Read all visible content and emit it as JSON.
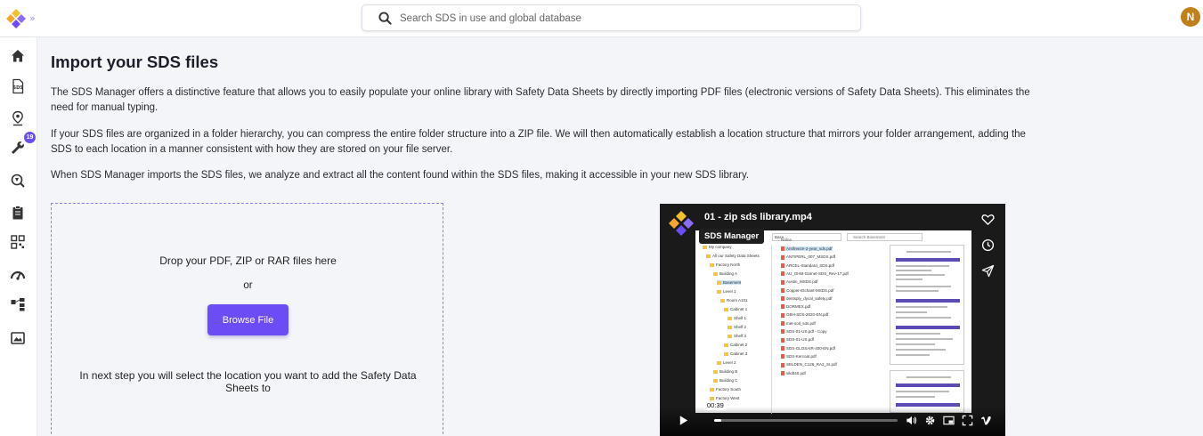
{
  "header": {
    "search_placeholder": "Search SDS in use and global database",
    "avatar_initial": "N"
  },
  "sidebar": {
    "items": [
      {
        "icon": "home-icon"
      },
      {
        "icon": "sds-document-icon",
        "label": "SDS"
      },
      {
        "icon": "location-pin-icon"
      },
      {
        "icon": "wrench-icon",
        "badge": "19"
      },
      {
        "icon": "search-chemical-icon"
      },
      {
        "icon": "clipboard-icon"
      },
      {
        "icon": "qr-code-icon"
      },
      {
        "icon": "risk-gauge-icon"
      },
      {
        "icon": "hierarchy-icon"
      },
      {
        "icon": "image-report-icon"
      }
    ]
  },
  "main": {
    "title": "Import your SDS files",
    "paragraphs": [
      "The SDS Manager offers a distinctive feature that allows you to easily populate your online library with Safety Data Sheets by directly importing PDF files (electronic versions of Safety Data Sheets). This eliminates the need for manual typing.",
      "If your SDS files are organized in a folder hierarchy, you can compress the entire folder structure into a ZIP file. We will then automatically establish a location structure that mirrors your folder arrangement, adding the SDS to each location in a manner consistent with how they are stored on your file server.",
      "When SDS Manager imports the SDS files, we analyze and extract all the content found within the SDS files, making it accessible in your new SDS library."
    ],
    "dropzone": {
      "drop_text": "Drop your PDF, ZIP or RAR files here",
      "or_text": "or",
      "browse_label": "Browse File",
      "hint": "In next step you will select the location you want to add the Safety Data Sheets to"
    }
  },
  "video": {
    "title": "01 - zip sds library.mp4",
    "brand": "SDS Manager",
    "time": "00:39",
    "progress_fraction": 0.04,
    "address": "Base...",
    "explorer_search": "Search Basement",
    "files_header": "Name",
    "tree": [
      "My company",
      "All our Safety Data Sheets",
      "Factory North",
      "Building A",
      "Basement",
      "Level 1",
      "Room A101",
      "Cabinet 1",
      "Shelf 1",
      "Shelf 2",
      "Shelf 3",
      "Cabinet 2",
      "Cabinet 3",
      "Level 2",
      "Building B",
      "Building C",
      "Factory South",
      "Factory West"
    ],
    "files": [
      "Antifreeze-2-year_sds.pdf",
      "ANTIPERL_007_MSDS.pdf",
      "ARCEL-Standard_SDS.pdf",
      "AU_GHM-Garnet-SDS_Rev-17.pdf",
      "Austin_MSDS.pdf",
      "Copper-Etchant-MSDS.pdf",
      "dentsply_dycal_safety.pdf",
      "DORMEX.pdf",
      "GBH-SDS-2020-EN.pdf",
      "met-soil_sds.pdf",
      "SDS-01-US.pdf - Copy",
      "SDS-01-US.pdf",
      "SDS-GLOSAIR-400-EN.pdf",
      "SDS-Kercoat.pdf",
      "SELDEN_C126_RA2_SI.pdf",
      "vikdt40.pdf"
    ]
  },
  "colors": {
    "accent": "#6c4cf5",
    "avatar": "#c1801a",
    "page_bg": "#f4f5f9"
  }
}
